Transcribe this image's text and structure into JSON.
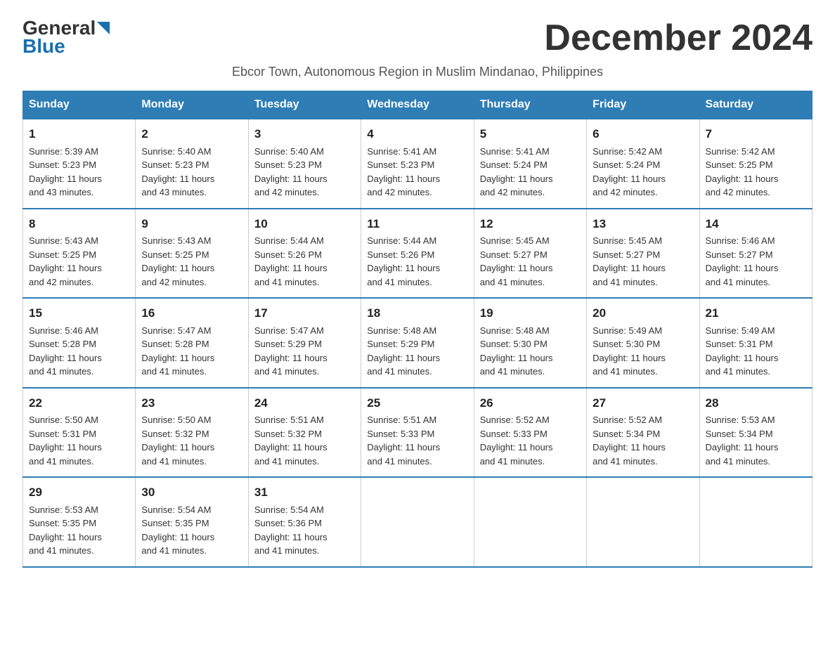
{
  "header": {
    "logo_general": "General",
    "logo_blue": "Blue",
    "title": "December 2024",
    "subtitle": "Ebcor Town, Autonomous Region in Muslim Mindanao, Philippines"
  },
  "columns": [
    "Sunday",
    "Monday",
    "Tuesday",
    "Wednesday",
    "Thursday",
    "Friday",
    "Saturday"
  ],
  "weeks": [
    [
      {
        "day": "1",
        "sunrise": "5:39 AM",
        "sunset": "5:23 PM",
        "daylight": "11 hours and 43 minutes."
      },
      {
        "day": "2",
        "sunrise": "5:40 AM",
        "sunset": "5:23 PM",
        "daylight": "11 hours and 43 minutes."
      },
      {
        "day": "3",
        "sunrise": "5:40 AM",
        "sunset": "5:23 PM",
        "daylight": "11 hours and 42 minutes."
      },
      {
        "day": "4",
        "sunrise": "5:41 AM",
        "sunset": "5:23 PM",
        "daylight": "11 hours and 42 minutes."
      },
      {
        "day": "5",
        "sunrise": "5:41 AM",
        "sunset": "5:24 PM",
        "daylight": "11 hours and 42 minutes."
      },
      {
        "day": "6",
        "sunrise": "5:42 AM",
        "sunset": "5:24 PM",
        "daylight": "11 hours and 42 minutes."
      },
      {
        "day": "7",
        "sunrise": "5:42 AM",
        "sunset": "5:25 PM",
        "daylight": "11 hours and 42 minutes."
      }
    ],
    [
      {
        "day": "8",
        "sunrise": "5:43 AM",
        "sunset": "5:25 PM",
        "daylight": "11 hours and 42 minutes."
      },
      {
        "day": "9",
        "sunrise": "5:43 AM",
        "sunset": "5:25 PM",
        "daylight": "11 hours and 42 minutes."
      },
      {
        "day": "10",
        "sunrise": "5:44 AM",
        "sunset": "5:26 PM",
        "daylight": "11 hours and 41 minutes."
      },
      {
        "day": "11",
        "sunrise": "5:44 AM",
        "sunset": "5:26 PM",
        "daylight": "11 hours and 41 minutes."
      },
      {
        "day": "12",
        "sunrise": "5:45 AM",
        "sunset": "5:27 PM",
        "daylight": "11 hours and 41 minutes."
      },
      {
        "day": "13",
        "sunrise": "5:45 AM",
        "sunset": "5:27 PM",
        "daylight": "11 hours and 41 minutes."
      },
      {
        "day": "14",
        "sunrise": "5:46 AM",
        "sunset": "5:27 PM",
        "daylight": "11 hours and 41 minutes."
      }
    ],
    [
      {
        "day": "15",
        "sunrise": "5:46 AM",
        "sunset": "5:28 PM",
        "daylight": "11 hours and 41 minutes."
      },
      {
        "day": "16",
        "sunrise": "5:47 AM",
        "sunset": "5:28 PM",
        "daylight": "11 hours and 41 minutes."
      },
      {
        "day": "17",
        "sunrise": "5:47 AM",
        "sunset": "5:29 PM",
        "daylight": "11 hours and 41 minutes."
      },
      {
        "day": "18",
        "sunrise": "5:48 AM",
        "sunset": "5:29 PM",
        "daylight": "11 hours and 41 minutes."
      },
      {
        "day": "19",
        "sunrise": "5:48 AM",
        "sunset": "5:30 PM",
        "daylight": "11 hours and 41 minutes."
      },
      {
        "day": "20",
        "sunrise": "5:49 AM",
        "sunset": "5:30 PM",
        "daylight": "11 hours and 41 minutes."
      },
      {
        "day": "21",
        "sunrise": "5:49 AM",
        "sunset": "5:31 PM",
        "daylight": "11 hours and 41 minutes."
      }
    ],
    [
      {
        "day": "22",
        "sunrise": "5:50 AM",
        "sunset": "5:31 PM",
        "daylight": "11 hours and 41 minutes."
      },
      {
        "day": "23",
        "sunrise": "5:50 AM",
        "sunset": "5:32 PM",
        "daylight": "11 hours and 41 minutes."
      },
      {
        "day": "24",
        "sunrise": "5:51 AM",
        "sunset": "5:32 PM",
        "daylight": "11 hours and 41 minutes."
      },
      {
        "day": "25",
        "sunrise": "5:51 AM",
        "sunset": "5:33 PM",
        "daylight": "11 hours and 41 minutes."
      },
      {
        "day": "26",
        "sunrise": "5:52 AM",
        "sunset": "5:33 PM",
        "daylight": "11 hours and 41 minutes."
      },
      {
        "day": "27",
        "sunrise": "5:52 AM",
        "sunset": "5:34 PM",
        "daylight": "11 hours and 41 minutes."
      },
      {
        "day": "28",
        "sunrise": "5:53 AM",
        "sunset": "5:34 PM",
        "daylight": "11 hours and 41 minutes."
      }
    ],
    [
      {
        "day": "29",
        "sunrise": "5:53 AM",
        "sunset": "5:35 PM",
        "daylight": "11 hours and 41 minutes."
      },
      {
        "day": "30",
        "sunrise": "5:54 AM",
        "sunset": "5:35 PM",
        "daylight": "11 hours and 41 minutes."
      },
      {
        "day": "31",
        "sunrise": "5:54 AM",
        "sunset": "5:36 PM",
        "daylight": "11 hours and 41 minutes."
      },
      null,
      null,
      null,
      null
    ]
  ],
  "labels": {
    "sunrise": "Sunrise:",
    "sunset": "Sunset:",
    "daylight": "Daylight:"
  }
}
